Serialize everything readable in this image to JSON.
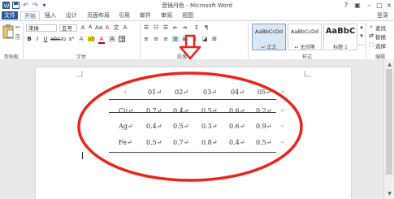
{
  "window": {
    "title": "音镜丹色 - Microsoft Word",
    "login": "登录"
  },
  "tabs": [
    "文件",
    "开始",
    "插入",
    "设计",
    "页面布局",
    "引用",
    "邮件",
    "审阅",
    "视图"
  ],
  "active_tab": "开始",
  "ribbon": {
    "font_name": "宋体",
    "font_size": "五号",
    "font_group_label": "字体",
    "paragraph_group_label": "段落",
    "styles_group_label": "样式",
    "clipboard_group_label": "剪贴板",
    "editing_group_label": "编辑",
    "styles": [
      {
        "sample": "AaBbCcDd",
        "name": "↵ 正文"
      },
      {
        "sample": "AaBbCcDd",
        "name": "↵ 无间隔"
      },
      {
        "sample": "AaBbC",
        "name": "标题 1"
      }
    ],
    "editing": [
      "查找",
      "替换",
      "选择"
    ]
  },
  "table": {
    "header": [
      "↵",
      "01↵",
      "02↵",
      "03↵",
      "04↵",
      "05↵"
    ],
    "rows": [
      [
        "Cu↵",
        "0.7↵",
        "0.4↵",
        "0.5↵",
        "0.6↵",
        "0.2↵"
      ],
      [
        "Ag↵",
        "0.4↵",
        "0.5↵",
        "0.3↵",
        "0.6↵",
        "0.9↵"
      ],
      [
        "Fe↵",
        "0.5↵",
        "0.7↵",
        "0.8↵",
        "0.4↵",
        "0.5↵"
      ]
    ],
    "end_marks": [
      "↵",
      "↵",
      "↵",
      "↵"
    ]
  },
  "colors": {
    "brand": "#2b579a",
    "annotation": "#e8261e"
  },
  "icons": [
    "save-icon",
    "undo-icon",
    "redo-icon",
    "paste-icon",
    "bold-icon",
    "italic-icon",
    "underline-icon",
    "align-center-icon",
    "find-icon",
    "replace-icon",
    "select-icon"
  ]
}
